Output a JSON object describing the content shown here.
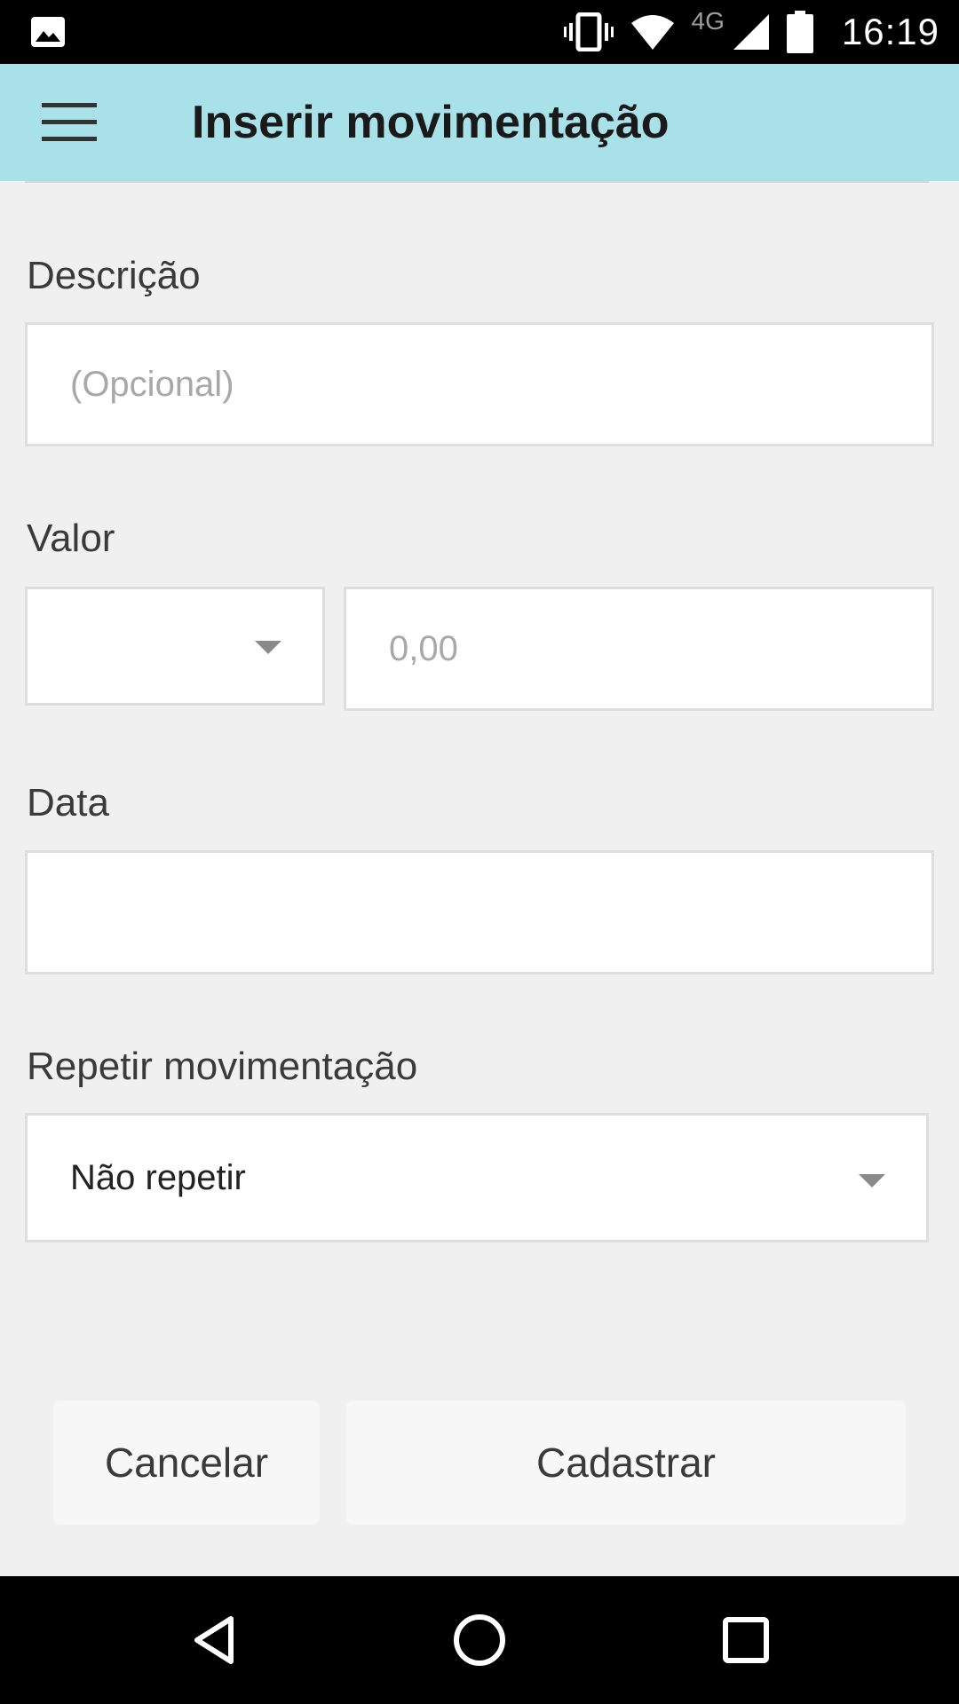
{
  "status_bar": {
    "time": "16:19",
    "network_label": "4G",
    "icons": [
      "image-notification-icon",
      "vibrate-icon",
      "wifi-icon",
      "cellular-signal-icon",
      "battery-icon"
    ]
  },
  "app_bar": {
    "title": "Inserir movimentação",
    "menu_icon": "hamburger-menu-icon",
    "background": "#a8e2e8"
  },
  "form": {
    "descricao": {
      "label": "Descrição",
      "placeholder": "(Opcional)",
      "value": ""
    },
    "valor": {
      "label": "Valor",
      "currency_value": "",
      "amount_placeholder": "0,00"
    },
    "data": {
      "label": "Data",
      "value": ""
    },
    "repetir": {
      "label": "Repetir movimentação",
      "selected": "Não repetir"
    }
  },
  "actions": {
    "cancel_label": "Cancelar",
    "submit_label": "Cadastrar"
  },
  "nav_bar": {
    "icons": [
      "back-icon",
      "home-icon",
      "recents-icon"
    ]
  }
}
